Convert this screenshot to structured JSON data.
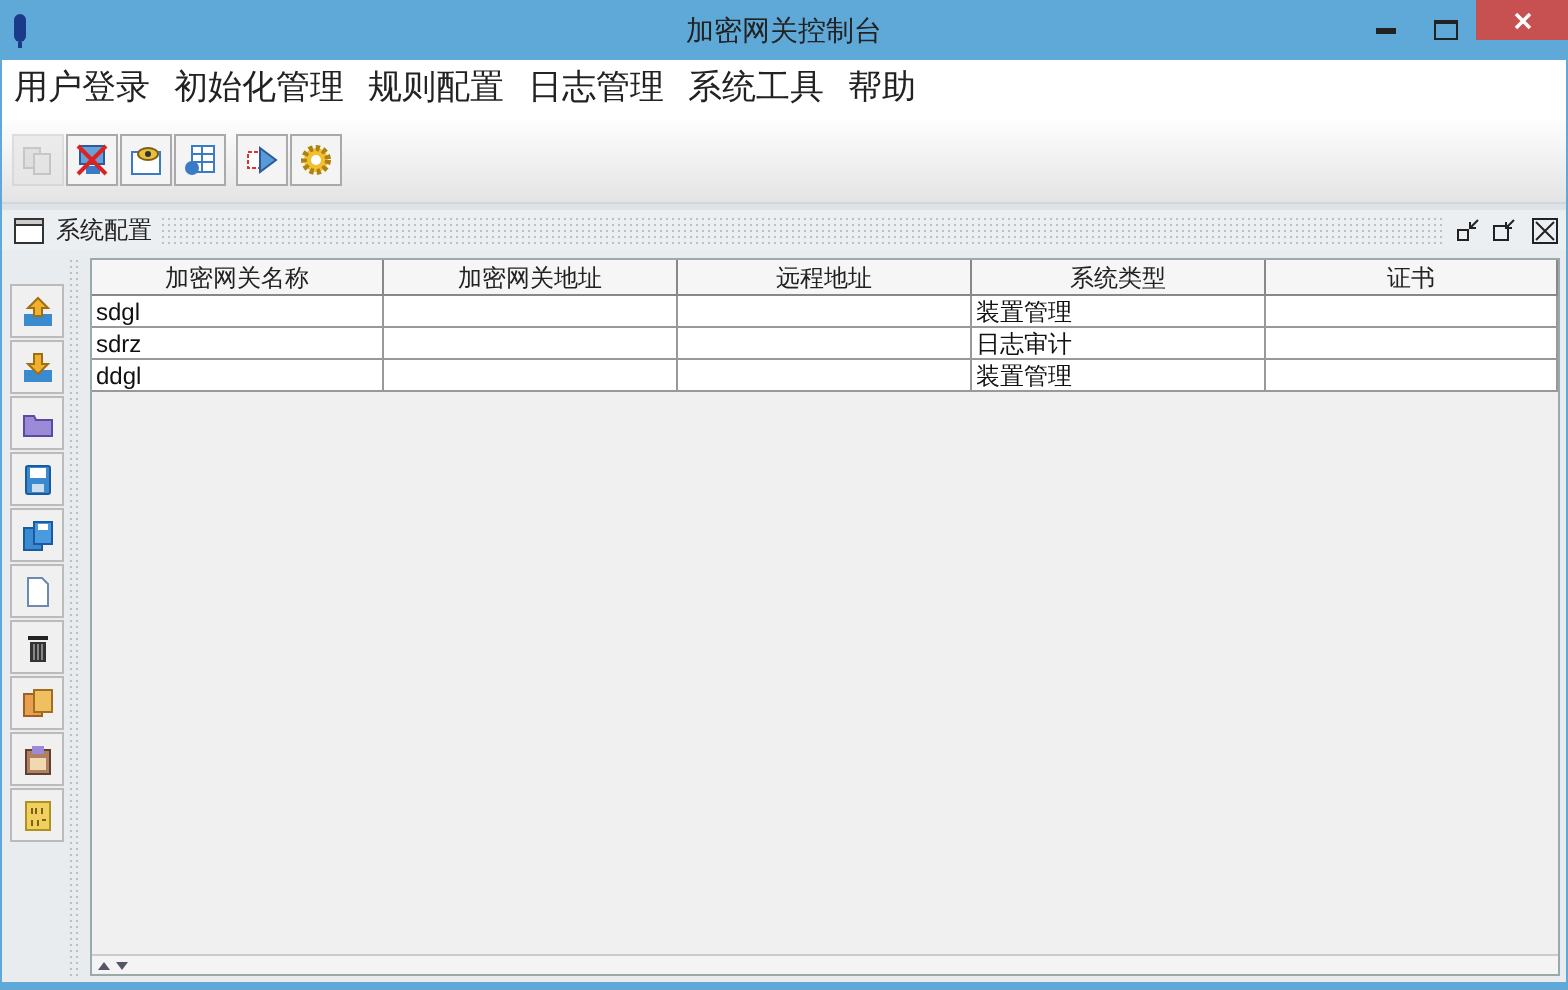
{
  "window": {
    "title": "加密网关控制台"
  },
  "menu": [
    "用户登录",
    "初始化管理",
    "规则配置",
    "日志管理",
    "系统工具",
    "帮助"
  ],
  "toolbar": [
    {
      "kind": "disabled-copy",
      "disabled": true
    },
    {
      "kind": "disconnect",
      "disabled": false
    },
    {
      "kind": "view",
      "disabled": false
    },
    {
      "kind": "table",
      "disabled": false
    },
    {
      "kind": "forward",
      "disabled": false
    },
    {
      "kind": "gear",
      "disabled": false
    }
  ],
  "panel": {
    "title": "系统配置"
  },
  "side_tools": [
    {
      "kind": "upload"
    },
    {
      "kind": "download"
    },
    {
      "kind": "folder"
    },
    {
      "kind": "save"
    },
    {
      "kind": "save-all"
    },
    {
      "kind": "new"
    },
    {
      "kind": "delete"
    },
    {
      "kind": "copy"
    },
    {
      "kind": "paste"
    },
    {
      "kind": "properties"
    }
  ],
  "table": {
    "columns": [
      "加密网关名称",
      "加密网关地址",
      "远程地址",
      "系统类型",
      "证书"
    ],
    "rows": [
      [
        "sdgl",
        "",
        "",
        "装置管理",
        ""
      ],
      [
        "sdrz",
        "",
        "",
        "日志审计",
        ""
      ],
      [
        "ddgl",
        "",
        "",
        "装置管理",
        ""
      ]
    ]
  }
}
